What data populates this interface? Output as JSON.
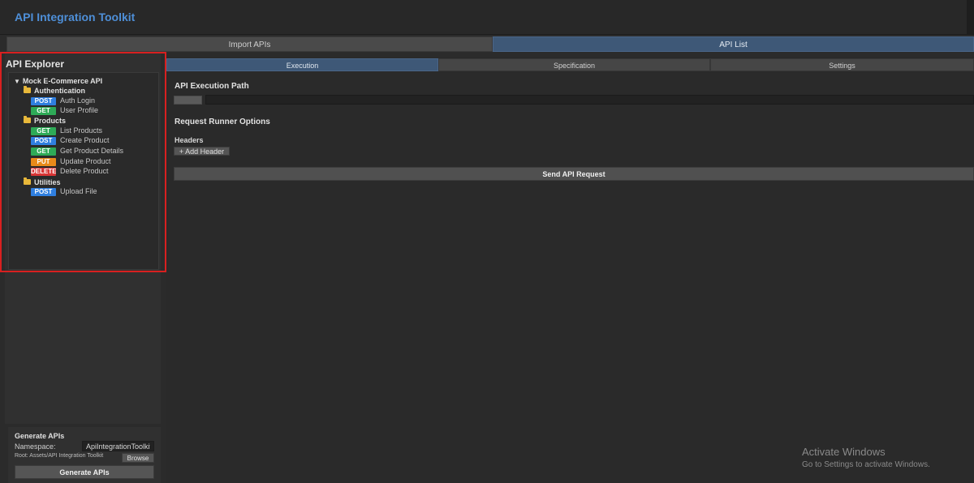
{
  "app": {
    "title": "API Integration Toolkit"
  },
  "main_tabs": [
    {
      "label": "Import APIs",
      "active": false
    },
    {
      "label": "API List",
      "active": true
    }
  ],
  "explorer": {
    "title": "API Explorer",
    "root": "Mock E-Commerce API",
    "folders": [
      {
        "name": "Authentication",
        "endpoints": [
          {
            "method": "POST",
            "label": "Auth Login"
          },
          {
            "method": "GET",
            "label": "User Profile"
          }
        ]
      },
      {
        "name": "Products",
        "endpoints": [
          {
            "method": "GET",
            "label": "List Products"
          },
          {
            "method": "POST",
            "label": "Create Product"
          },
          {
            "method": "GET",
            "label": "Get Product Details"
          },
          {
            "method": "PUT",
            "label": "Update Product"
          },
          {
            "method": "DELETE",
            "label": "Delete Product"
          }
        ]
      },
      {
        "name": "Utilities",
        "endpoints": [
          {
            "method": "POST",
            "label": "Upload File"
          }
        ]
      }
    ]
  },
  "generate": {
    "title": "Generate APIs",
    "namespace_label": "Namespace:",
    "namespace_value": "ApiIntegrationToolkit",
    "root_label": "Root: Assets/API Integration Toolkit",
    "browse_label": "Browse",
    "button_label": "Generate APIs"
  },
  "sub_tabs": [
    {
      "label": "Execution",
      "active": true
    },
    {
      "label": "Specification",
      "active": false
    },
    {
      "label": "Settings",
      "active": false
    }
  ],
  "execution": {
    "path_title": "API Execution Path",
    "path_value": "",
    "runner_title": "Request Runner Options",
    "headers_label": "Headers",
    "add_header_label": "+ Add Header",
    "send_label": "Send API Request"
  },
  "watermark": {
    "title": "Activate Windows",
    "subtitle": "Go to Settings to activate Windows."
  },
  "colors": {
    "accent_title": "#4e8fd8",
    "active_tab": "#3e5877",
    "highlight_border": "#d82020",
    "post": "#2f7fe0",
    "get": "#2eaa57",
    "put": "#e88a1a",
    "delete": "#d93535"
  }
}
